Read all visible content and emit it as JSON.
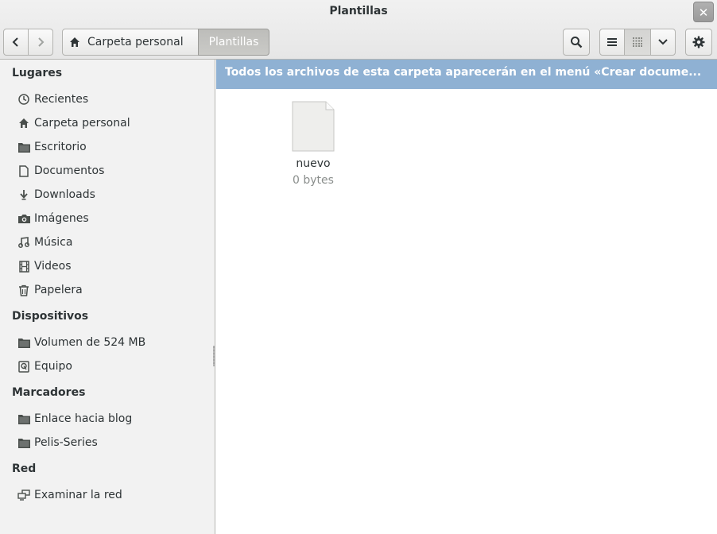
{
  "window": {
    "title": "Plantillas",
    "close_glyph": "✕"
  },
  "toolbar": {
    "back_icon": "go-back-icon",
    "forward_icon": "go-forward-icon",
    "breadcrumbs": [
      {
        "label": "Carpeta personal",
        "icon": "home-icon"
      },
      {
        "label": "Plantillas"
      }
    ],
    "search_icon": "search-icon",
    "list_view_icon": "list-view-icon",
    "grid_view_icon": "grid-view-icon",
    "view_menu_icon": "chevron-down-icon",
    "settings_icon": "gear-icon"
  },
  "sidebar": {
    "sections": [
      {
        "title": "Lugares",
        "items": [
          {
            "label": "Recientes",
            "icon": "clock-icon"
          },
          {
            "label": "Carpeta personal",
            "icon": "home-icon"
          },
          {
            "label": "Escritorio",
            "icon": "folder-icon"
          },
          {
            "label": "Documentos",
            "icon": "document-icon"
          },
          {
            "label": "Downloads",
            "icon": "download-icon"
          },
          {
            "label": "Imágenes",
            "icon": "camera-icon"
          },
          {
            "label": "Música",
            "icon": "music-icon"
          },
          {
            "label": "Videos",
            "icon": "film-icon"
          },
          {
            "label": "Papelera",
            "icon": "trash-icon"
          }
        ]
      },
      {
        "title": "Dispositivos",
        "items": [
          {
            "label": "Volumen de 524 MB",
            "icon": "folder-icon"
          },
          {
            "label": "Equipo",
            "icon": "drive-icon"
          }
        ]
      },
      {
        "title": "Marcadores",
        "items": [
          {
            "label": "Enlace hacia blog",
            "icon": "folder-icon"
          },
          {
            "label": "Pelis-Series",
            "icon": "folder-icon"
          }
        ]
      },
      {
        "title": "Red",
        "items": [
          {
            "label": "Examinar la red",
            "icon": "network-icon"
          }
        ]
      }
    ]
  },
  "infobar": {
    "message": "Todos los archivos de esta carpeta aparecerán en el menú «Crear docume..."
  },
  "files": [
    {
      "name": "nuevo",
      "size": "0 bytes",
      "icon": "blank-file-icon"
    }
  ],
  "colors": {
    "infobar_bg": "#8fb1d3",
    "selected_crumb_bg": "#c4c4c1"
  }
}
